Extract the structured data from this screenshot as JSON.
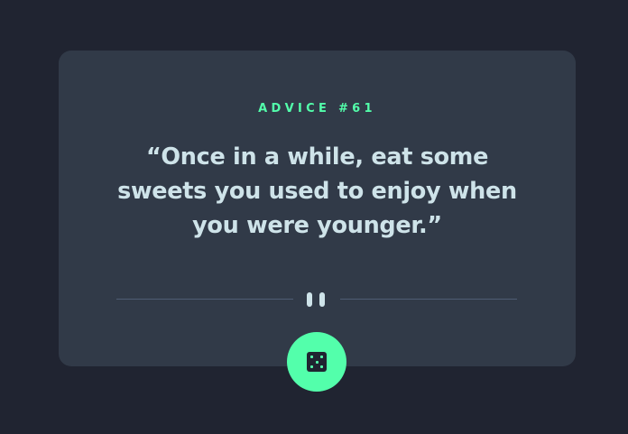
{
  "card": {
    "advice_id": "ADVICE #61",
    "quote": "“Once in a while, eat some sweets you used to enjoy when you were younger.”"
  },
  "divider": {
    "icon": "pause-icon"
  },
  "dice_button": {
    "icon": "dice-icon"
  },
  "colors": {
    "background": "#202431",
    "card": "#313a48",
    "accent": "#53ffab",
    "text": "#cee3e9",
    "divider": "#4f5d74"
  }
}
